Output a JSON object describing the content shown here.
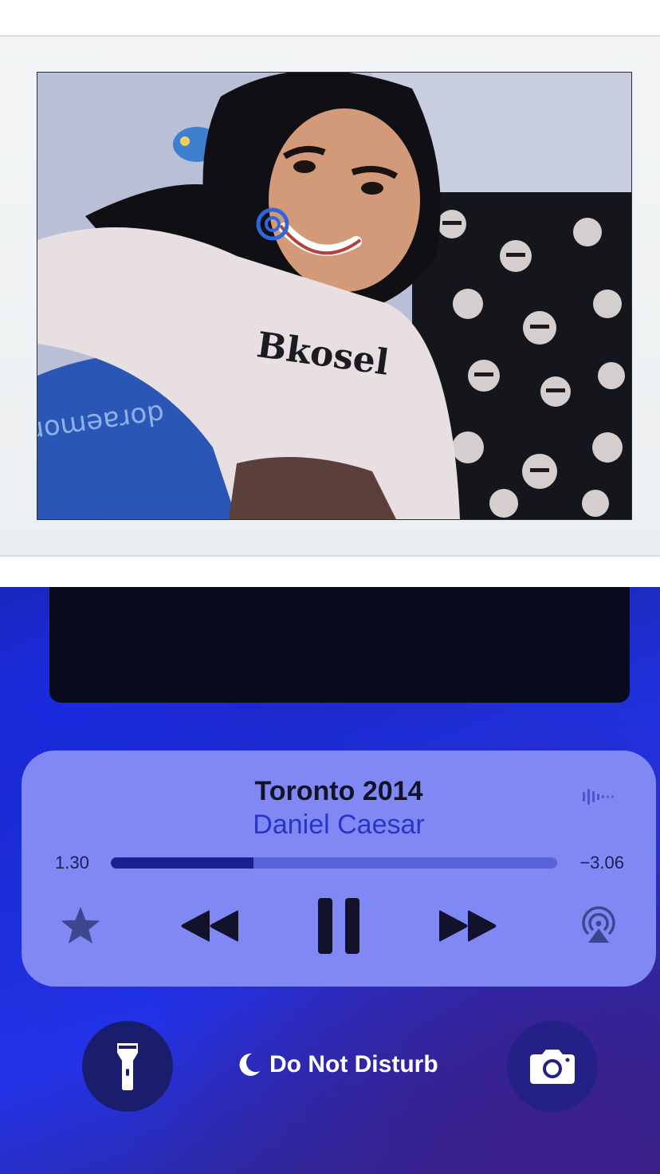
{
  "photo": {
    "shirt_text": "Bkosel",
    "pillow_text": "doraemon"
  },
  "now_playing": {
    "title": "Toronto 2014",
    "artist": "Daniel Caesar",
    "elapsed": "1.30",
    "remaining": "−3.06",
    "progress_fraction": 0.32,
    "icons": {
      "waveform": "waveform-icon",
      "star": "star-icon",
      "rewind": "rewind-icon",
      "pause": "pause-icon",
      "forward": "fast-forward-icon",
      "airplay": "airplay-icon"
    }
  },
  "lock_controls": {
    "flashlight_icon": "flashlight-icon",
    "focus_label": "Do Not Disturb",
    "focus_icon": "moon-icon",
    "camera_icon": "camera-icon"
  },
  "colors": {
    "player_bg": "#8088f4",
    "accent": "#2c34c7",
    "background_blue": "#2333e8"
  }
}
